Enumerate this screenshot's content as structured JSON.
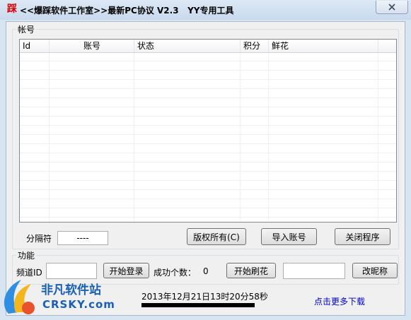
{
  "window": {
    "app_icon_glyph": "踩",
    "title": "<<爆踩软件工作室>>最新PC协议 V2.3   YY专用工具"
  },
  "accounts_group": {
    "label": "帐号",
    "columns": [
      "Id",
      "账号",
      "状态",
      "积分",
      "鲜花"
    ],
    "separator_label": "分隔符",
    "separator_value": "----",
    "copyright_button": "版权所有(C)",
    "import_button": "导入账号",
    "close_button": "关闭程序"
  },
  "function_group": {
    "label": "功能",
    "channel_label": "频道ID",
    "channel_value": "",
    "login_button": "开始登录",
    "success_label": "成功个数：",
    "success_count": "0",
    "flower_button": "开始刷花",
    "nickname_value": "",
    "rename_button": "改昵称"
  },
  "status": {
    "datetime": "2013年12月21日13时20分58秒",
    "more_link": "点击更多下载"
  },
  "watermark": {
    "text_cn": "非凡软件站",
    "text_en": "CRSKY.com"
  }
}
